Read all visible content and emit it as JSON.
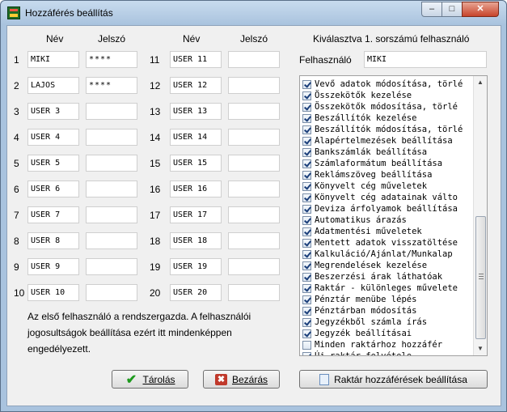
{
  "window": {
    "title": "Hozzáférés beállítás",
    "controls": {
      "minimize": "–",
      "maximize": "□",
      "close": "✕"
    }
  },
  "columns": {
    "left_name": "Név",
    "left_password": "Jelszó",
    "right_name": "Név",
    "right_password": "Jelszó"
  },
  "users_left": [
    {
      "num": "1",
      "name": "MIKI",
      "password": "****"
    },
    {
      "num": "2",
      "name": "LAJOS",
      "password": "****"
    },
    {
      "num": "3",
      "name": "USER 3",
      "password": ""
    },
    {
      "num": "4",
      "name": "USER 4",
      "password": ""
    },
    {
      "num": "5",
      "name": "USER 5",
      "password": ""
    },
    {
      "num": "6",
      "name": "USER 6",
      "password": ""
    },
    {
      "num": "7",
      "name": "USER 7",
      "password": ""
    },
    {
      "num": "8",
      "name": "USER 8",
      "password": ""
    },
    {
      "num": "9",
      "name": "USER 9",
      "password": ""
    },
    {
      "num": "10",
      "name": "USER 10",
      "password": ""
    }
  ],
  "users_right": [
    {
      "num": "11",
      "name": "USER 11",
      "password": ""
    },
    {
      "num": "12",
      "name": "USER 12",
      "password": ""
    },
    {
      "num": "13",
      "name": "USER 13",
      "password": ""
    },
    {
      "num": "14",
      "name": "USER 14",
      "password": ""
    },
    {
      "num": "15",
      "name": "USER 15",
      "password": ""
    },
    {
      "num": "16",
      "name": "USER 16",
      "password": ""
    },
    {
      "num": "17",
      "name": "USER 17",
      "password": ""
    },
    {
      "num": "18",
      "name": "USER 18",
      "password": ""
    },
    {
      "num": "19",
      "name": "USER 19",
      "password": ""
    },
    {
      "num": "20",
      "name": "USER 20",
      "password": ""
    }
  ],
  "selected_panel": {
    "heading": "Kiválasztva 1. sorszámú felhasználó",
    "user_label": "Felhasználó",
    "user_value": "MIKI"
  },
  "permissions": [
    {
      "label": "Vevő adatok módosítása, törlé",
      "checked": true
    },
    {
      "label": "Összekötők kezelése",
      "checked": true
    },
    {
      "label": "Összekötők módosítása, törlé",
      "checked": true
    },
    {
      "label": "Beszállítók kezelése",
      "checked": true
    },
    {
      "label": "Beszállítók módosítása, törlé",
      "checked": true
    },
    {
      "label": "Alapértelmezések beállítása",
      "checked": true
    },
    {
      "label": "Bankszámlák beállítása",
      "checked": true
    },
    {
      "label": "Számlaformátum beállítása",
      "checked": true
    },
    {
      "label": "Reklámszöveg beállítása",
      "checked": true
    },
    {
      "label": "Könyvelt cég műveletek",
      "checked": true
    },
    {
      "label": "Könyvelt cég adatainak válto",
      "checked": true
    },
    {
      "label": "Deviza árfolyamok beállítása",
      "checked": true
    },
    {
      "label": "Automatikus árazás",
      "checked": true
    },
    {
      "label": "Adatmentési műveletek",
      "checked": true
    },
    {
      "label": "Mentett adatok visszatöltése",
      "checked": true
    },
    {
      "label": "Kalkuláció/Ajánlat/Munkalap",
      "checked": true
    },
    {
      "label": "Megrendelések kezelése",
      "checked": true
    },
    {
      "label": "Beszerzési árak láthatóak",
      "checked": true
    },
    {
      "label": "Raktár - különleges művelete",
      "checked": true
    },
    {
      "label": "Pénztár menübe lépés",
      "checked": true
    },
    {
      "label": "Pénztárban módosítás",
      "checked": true
    },
    {
      "label": "Jegyzékből számla írás",
      "checked": true
    },
    {
      "label": "Jegyzék beállításai",
      "checked": true
    },
    {
      "label": "Minden raktárhoz hozzáfér",
      "checked": false
    },
    {
      "label": "Új raktár felvétele",
      "checked": true
    }
  ],
  "note": "Az első felhasználó a rendszergazda. A felhasználói jogosultságok beállítása ezért itt mindenképpen engedélyezett.",
  "buttons": {
    "save": "Tárolás",
    "close": "Bezárás",
    "warehouse": "Raktár hozzáférések beállítása"
  },
  "icons": {
    "app": "app-icon",
    "save": "checkmark-icon",
    "close": "red-x-icon",
    "warehouse": "document-icon"
  }
}
